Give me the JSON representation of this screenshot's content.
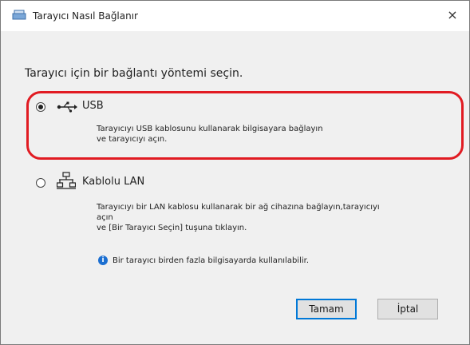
{
  "window": {
    "title": "Tarayıcı Nasıl Bağlanır",
    "close_label": "×"
  },
  "prompt": "Tarayıcı için bir bağlantı yöntemi seçin.",
  "options": [
    {
      "label": "USB",
      "selected": true,
      "icon": "usb-icon",
      "desc_lines": [
        "Tarayıcıyı USB kablosunu kullanarak bilgisayara bağlayın",
        "ve tarayıcıyı açın."
      ]
    },
    {
      "label": "Kablolu LAN",
      "selected": false,
      "icon": "lan-icon",
      "desc_lines": [
        "Tarayıcıyı bir LAN kablosu kullanarak bir ağ cihazına bağlayın,tarayıcıyı",
        "açın",
        "ve [Bir Tarayıcı Seçin] tuşuna tıklayın."
      ],
      "info": "Bir tarayıcı birden fazla bilgisayarda kullanılabilir."
    }
  ],
  "buttons": {
    "ok": "Tamam",
    "cancel": "İptal"
  },
  "colors": {
    "highlight": "#e11b22",
    "default_button_border": "#0078d7",
    "info_icon": "#1c6fd1"
  }
}
